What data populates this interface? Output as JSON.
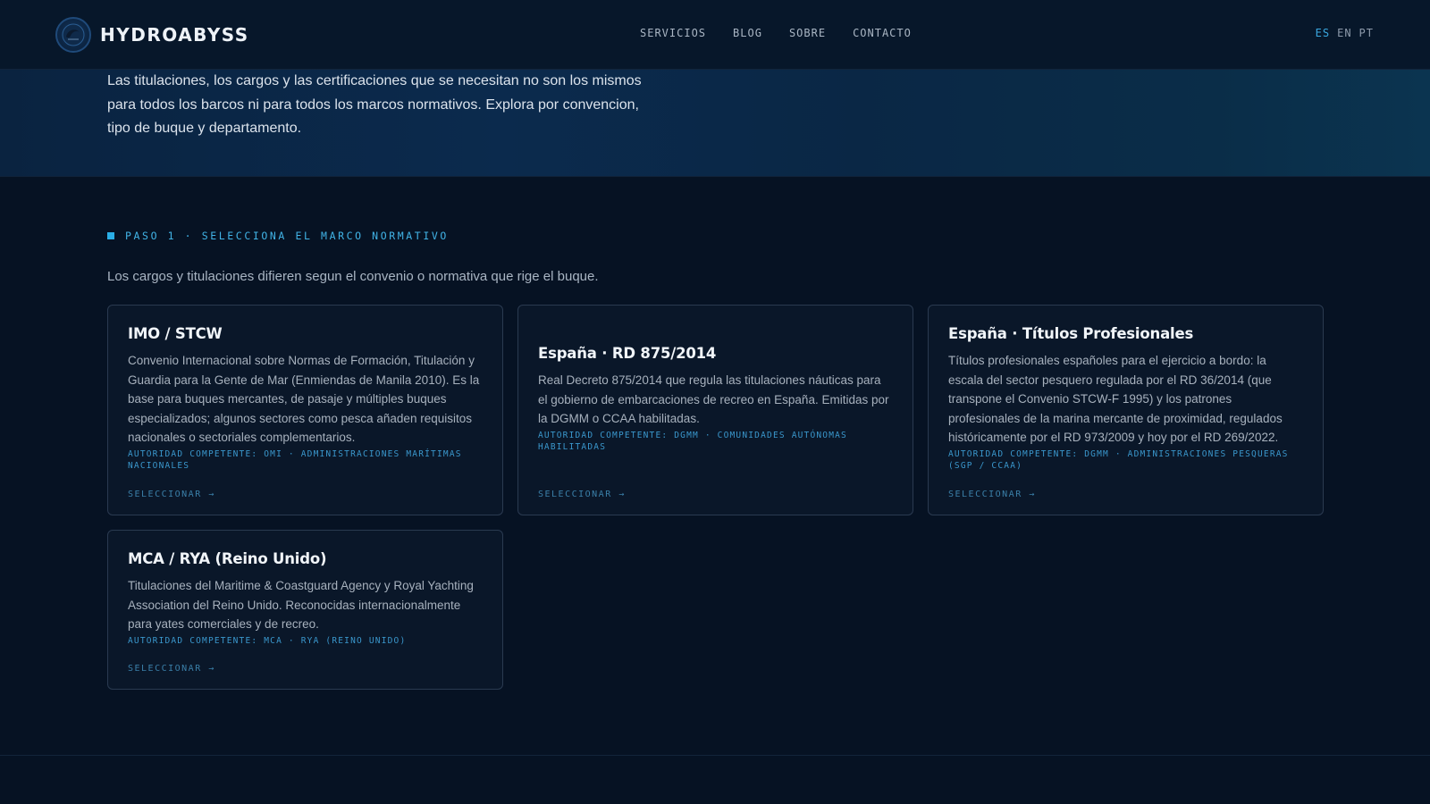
{
  "header": {
    "brand": "HYDROABYSS",
    "nav": [
      "SERVICIOS",
      "BLOG",
      "SOBRE",
      "CONTACTO"
    ],
    "languages": [
      "ES",
      "EN",
      "PT"
    ],
    "active_language": "ES"
  },
  "hero": {
    "intro": "Las titulaciones, los cargos y las certificaciones que se necesitan no son los mismos para todos los barcos ni para todos los marcos normativos. Explora por convencion, tipo de buque y departamento."
  },
  "step": {
    "label": "PASO 1 · SELECCIONA EL MARCO NORMATIVO",
    "description": "Los cargos y titulaciones difieren segun el convenio o normativa que rige el buque."
  },
  "cards": [
    {
      "title": "IMO / STCW",
      "description": "Convenio Internacional sobre Normas de Formación, Titulación y Guardia para la Gente de Mar (Enmiendas de Manila 2010). Es la base para buques mercantes, de pasaje y múltiples buques especializados; algunos sectores como pesca añaden requisitos nacionales o sectoriales complementarios.",
      "authority": "AUTORIDAD COMPETENTE: OMI · ADMINISTRACIONES MARÍTIMAS NACIONALES",
      "action": "SELECCIONAR →"
    },
    {
      "title": "España · RD 875/2014",
      "description": "Real Decreto 875/2014 que regula las titulaciones náuticas para el gobierno de embarcaciones de recreo en España. Emitidas por la DGMM o CCAA habilitadas.",
      "authority": "AUTORIDAD COMPETENTE: DGMM · COMUNIDADES AUTÓNOMAS HABILITADAS",
      "action": "SELECCIONAR →"
    },
    {
      "title": "España · Títulos Profesionales",
      "description": "Títulos profesionales españoles para el ejercicio a bordo: la escala del sector pesquero regulada por el RD 36/2014 (que transpone el Convenio STCW-F 1995) y los patrones profesionales de la marina mercante de proximidad, regulados históricamente por el RD 973/2009 y hoy por el RD 269/2022.",
      "authority": "AUTORIDAD COMPETENTE: DGMM · ADMINISTRACIONES PESQUERAS (SGP / CCAA)",
      "action": "SELECCIONAR →"
    },
    {
      "title": "MCA / RYA (Reino Unido)",
      "description": "Titulaciones del Maritime & Coastguard Agency y Royal Yachting Association del Reino Unido. Reconocidas internacionalmente para yates comerciales y de recreo.",
      "authority": "AUTORIDAD COMPETENTE: MCA · RYA (REINO UNIDO)",
      "action": "SELECCIONAR →"
    }
  ]
}
